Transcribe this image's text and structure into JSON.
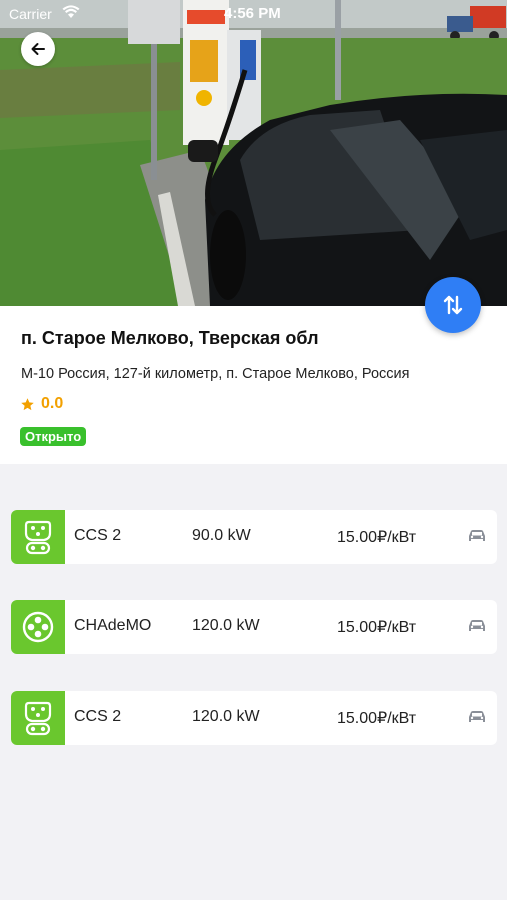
{
  "status_bar": {
    "carrier": "Carrier",
    "time": "4:56 PM"
  },
  "station": {
    "title": "п. Старое Мелково, Тверская обл",
    "address": "М-10 Россия, 127-й километр, п. Старое Мелково, Россия",
    "rating": "0.0",
    "status": "Открыто"
  },
  "connectors": [
    {
      "type": "CCS 2",
      "power": "90.0 kW",
      "price": "15.00₽/кВт",
      "icon": "ccs2-connector-icon"
    },
    {
      "type": "CHAdeMO",
      "power": "120.0 kW",
      "price": "15.00₽/кВт",
      "icon": "chademo-connector-icon"
    },
    {
      "type": "CCS 2",
      "power": "120.0 kW",
      "price": "15.00₽/кВт",
      "icon": "ccs2-connector-icon"
    }
  ],
  "colors": {
    "accent_blue": "#2f7ef5",
    "connector_green": "#6ac72e",
    "status_green": "#39c02c",
    "rating_orange": "#f2a000"
  }
}
